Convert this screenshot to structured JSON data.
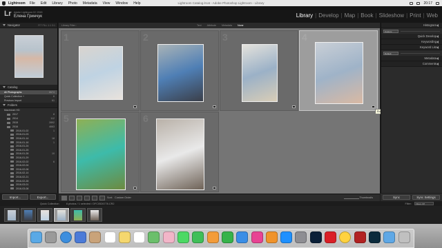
{
  "menubar": {
    "app_name": "Lightroom",
    "items": [
      "File",
      "Edit",
      "Library",
      "Photo",
      "Metadata",
      "View",
      "Window",
      "Help"
    ],
    "window_title": "Lightroom Catalog.lrcat - Adobe Photoshop Lightroom - Library",
    "clock": "20:17"
  },
  "identity": {
    "line1": "Adobe Lightroom CC 2015",
    "name": "Елена Гринчук"
  },
  "modules": [
    "Library",
    "Develop",
    "Map",
    "Book",
    "Slideshow",
    "Print",
    "Web"
  ],
  "left_panel": {
    "navigator": {
      "title": "Navigator",
      "zoom": "FIT   FILL   1:1   3:1"
    },
    "catalog": {
      "title": "Catalog",
      "items": [
        {
          "label": "All Photographs",
          "count": "8674"
        },
        {
          "label": "Quick Collection +",
          "count": "6"
        },
        {
          "label": "Previous Import",
          "count": "61"
        }
      ]
    },
    "folders": {
      "title": "Folders",
      "volume": {
        "label": "Macintosh HD",
        "count": ""
      },
      "years": [
        {
          "label": "2017",
          "count": "8"
        },
        {
          "label": "2014",
          "count": "112"
        },
        {
          "label": "2015",
          "count": "2892"
        },
        {
          "label": "2016",
          "count": "4663"
        }
      ],
      "subfolders": [
        {
          "label": "2016-01-02",
          "count": "1"
        },
        {
          "label": "2016-01-03",
          "count": ""
        },
        {
          "label": "2016-01-14",
          "count": "18"
        },
        {
          "label": "2016-01-16",
          "count": "1"
        },
        {
          "label": "2016-01-24",
          "count": ""
        },
        {
          "label": "2016-01-25",
          "count": ""
        },
        {
          "label": "2016-01-28",
          "count": "10"
        },
        {
          "label": "2016-01-29",
          "count": ""
        },
        {
          "label": "2016-02-02",
          "count": "6"
        },
        {
          "label": "2016-02-04",
          "count": ""
        },
        {
          "label": "2016-02-08",
          "count": ""
        },
        {
          "label": "2016-02-14",
          "count": ""
        },
        {
          "label": "2016-02-21",
          "count": ""
        },
        {
          "label": "2016-02-28",
          "count": ""
        },
        {
          "label": "2016-03-01",
          "count": ""
        },
        {
          "label": "2016-03-08",
          "count": ""
        }
      ]
    },
    "import_label": "Import...",
    "export_label": "Export..."
  },
  "grid_header": {
    "filter_label": "Library Filter :",
    "tabs": [
      "Text",
      "Attribute",
      "Metadata",
      "None"
    ],
    "active_tab": "None"
  },
  "grid": {
    "cells": [
      {
        "num": "1",
        "colors": [
          "#d9d4cf",
          "#bfd3e3",
          "#e8e2dc"
        ]
      },
      {
        "num": "2",
        "colors": [
          "#a9b3b7",
          "#4f7fb5",
          "#3b3f49"
        ]
      },
      {
        "num": "3",
        "colors": [
          "#e4e2dc",
          "#9bb1c7",
          "#d8cdb7"
        ]
      },
      {
        "num": "4",
        "colors": [
          "#c9cfd6",
          "#9fb3c8",
          "#d9b9a3"
        ]
      },
      {
        "num": "5",
        "colors": [
          "#8fb054",
          "#3dbbaa",
          "#6d8a3f"
        ]
      },
      {
        "num": "6",
        "colors": [
          "#b9b1a8",
          "#e9e9e9",
          "#6e6257"
        ]
      }
    ],
    "tooltip": "Rotate Photo Clockwise"
  },
  "right_panel": {
    "histogram": "Histogram",
    "quick_develop": "Quick Develop",
    "keywording": "Keywording",
    "keyword_list": "Keyword List",
    "metadata": "Metadata",
    "comments": "Comments",
    "qd_preset_1": "Custom",
    "qd_preset_2": "Default",
    "sync_label": "Sync",
    "sync_settings_label": "Sync Settings"
  },
  "toolbar": {
    "sort_label": "Sort:",
    "sort_value": "Custom Order",
    "thumbnails_label": "Thumbnails"
  },
  "filmstrip_bar": {
    "source": "Quick Collection",
    "info": "6 photos / 1 selected / DFC0526778.CR2",
    "filter_label": "Filter:",
    "filter_value": "Filters Off"
  },
  "filmstrip": [
    {
      "colors": [
        "#c9cfd6",
        "#9fb3c8"
      ]
    },
    {
      "colors": [
        "#4f7fb5",
        "#3b3f49"
      ]
    },
    {
      "colors": [
        "#e8e2dc",
        "#bfd3e3"
      ]
    },
    {
      "colors": [
        "#e4e2dc",
        "#9bb1c7"
      ]
    },
    {
      "colors": [
        "#3dbbaa",
        "#8fb054"
      ]
    },
    {
      "colors": [
        "#e9e9e9",
        "#6e6257"
      ]
    }
  ],
  "dock": [
    "finder-icon",
    "launchpad-icon",
    "safari-icon",
    "mail-icon",
    "contacts-icon",
    "calendar-icon",
    "notes-icon",
    "reminders-icon",
    "maps-icon",
    "photos-icon",
    "messages-icon",
    "facetime-icon",
    "pages-icon",
    "numbers-icon",
    "keynote-icon",
    "itunes-icon",
    "ibooks-icon",
    "appstore-icon",
    "preferences-icon",
    "photoshop-icon",
    "creative-cloud-icon",
    "chrome-icon",
    "filezilla-icon",
    "lightroom-icon",
    "downloads-icon",
    "trash-icon"
  ]
}
